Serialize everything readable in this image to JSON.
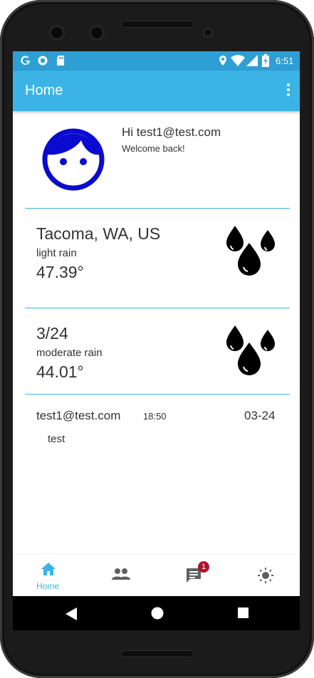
{
  "status_bar": {
    "time": "6:51"
  },
  "app_bar": {
    "title": "Home",
    "menu_icon": "overflow-menu-icon"
  },
  "profile": {
    "avatar_icon": "face-icon",
    "greeting": "Hi test1@test.com",
    "subtext": "Welcome back!"
  },
  "weather_cards": [
    {
      "title": "Tacoma, WA, US",
      "condition": "light rain",
      "temperature": "47.39°",
      "icon": "rain-drops-icon"
    },
    {
      "title": "3/24",
      "condition": "moderate rain",
      "temperature": "44.01°",
      "icon": "rain-drops-icon"
    }
  ],
  "message": {
    "sender": "test1@test.com",
    "time": "18:50",
    "date": "03-24",
    "body": "test"
  },
  "bottom_nav": {
    "items": [
      {
        "label": "Home",
        "icon": "home-icon",
        "active": true
      },
      {
        "label": "",
        "icon": "people-icon"
      },
      {
        "label": "",
        "icon": "chat-icon",
        "badge": "1"
      },
      {
        "label": "",
        "icon": "brightness-icon"
      }
    ]
  },
  "colors": {
    "accent": "#3bb4e5",
    "status_bar": "#2e9fd4",
    "avatar": "#0a0ad0",
    "badge": "#b0122a"
  }
}
